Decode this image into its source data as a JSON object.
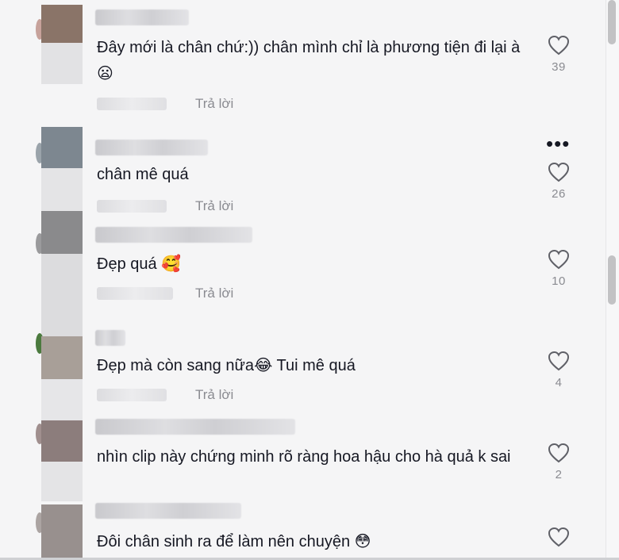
{
  "reply_label": "Trả lời",
  "more_label": "•••",
  "comments": [
    {
      "text": "Đây mới là chân chứ:)) chân mình chỉ là phương tiện đi lại à",
      "emoji": "😦",
      "likes": "39",
      "avatar_color": "#8a7468"
    },
    {
      "text": "chân mê quá",
      "emoji": "",
      "likes": "26",
      "avatar_color": "#7d8790"
    },
    {
      "text": "Đẹp quá ",
      "emoji": "🥰",
      "likes": "10",
      "avatar_color": "#8a8a8c"
    },
    {
      "text": "Đẹp mà còn sang nữa",
      "emoji": "😂",
      "text_after": " Tui mê quá",
      "likes": "4",
      "avatar_color": "#a89f98"
    },
    {
      "text": "nhìn clip này chứng minh rõ ràng hoa hậu cho hà quả k sai",
      "emoji": "",
      "likes": "2",
      "avatar_color": "#8c7d7c"
    },
    {
      "text": "Đôi chân sinh ra để làm nên chuyện ",
      "emoji": "😳",
      "likes": "",
      "avatar_color": "#98908e"
    }
  ]
}
